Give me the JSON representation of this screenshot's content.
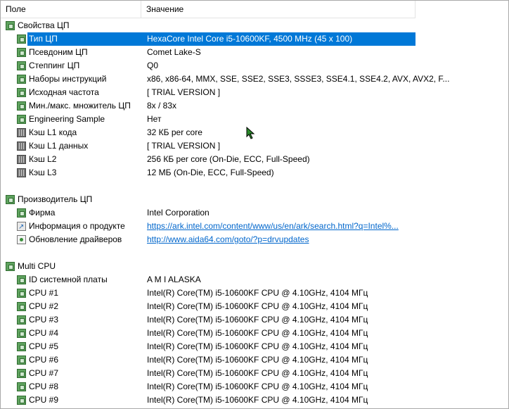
{
  "header": {
    "field_label": "Поле",
    "value_label": "Значение"
  },
  "sections": [
    {
      "title": "Свойства ЦП",
      "items": [
        {
          "label": "Тип ЦП",
          "value": "HexaCore Intel Core i5-10600KF, 4500 MHz (45 x 100)",
          "icon": "green-square-icon",
          "selected": true
        },
        {
          "label": "Псевдоним ЦП",
          "value": "Comet Lake-S",
          "icon": "green-square-icon"
        },
        {
          "label": "Степпинг ЦП",
          "value": "Q0",
          "icon": "green-square-icon"
        },
        {
          "label": "Наборы инструкций",
          "value": "x86, x86-64, MMX, SSE, SSE2, SSE3, SSSE3, SSE4.1, SSE4.2, AVX, AVX2, F...",
          "icon": "green-square-icon"
        },
        {
          "label": "Исходная частота",
          "value": "[ TRIAL VERSION ]",
          "icon": "green-square-icon"
        },
        {
          "label": "Мин./макс. множитель ЦП",
          "value": "8x / 83x",
          "icon": "green-square-icon"
        },
        {
          "label": "Engineering Sample",
          "value": "Нет",
          "icon": "green-square-icon"
        },
        {
          "label": "Кэш L1 кода",
          "value": "32 КБ per core",
          "icon": "memory-chip-icon"
        },
        {
          "label": "Кэш L1 данных",
          "value": "[ TRIAL VERSION ]",
          "icon": "memory-chip-icon"
        },
        {
          "label": "Кэш L2",
          "value": "256 КБ per core  (On-Die, ECC, Full-Speed)",
          "icon": "memory-chip-icon"
        },
        {
          "label": "Кэш L3",
          "value": "12 МБ  (On-Die, ECC, Full-Speed)",
          "icon": "memory-chip-icon"
        }
      ]
    },
    {
      "title": "Производитель ЦП",
      "items": [
        {
          "label": "Фирма",
          "value": "Intel Corporation",
          "icon": "green-square-icon"
        },
        {
          "label": "Информация о продукте",
          "value": "https://ark.intel.com/content/www/us/en/ark/search.html?q=Intel%...",
          "icon": "link-icon",
          "link": true
        },
        {
          "label": "Обновление драйверов",
          "value": "http://www.aida64.com/goto/?p=drvupdates",
          "icon": "update-icon",
          "link": true
        }
      ]
    },
    {
      "title": "Multi CPU",
      "items": [
        {
          "label": "ID системной платы",
          "value": "A M I ALASKA",
          "icon": "green-square-icon"
        },
        {
          "label": "CPU #1",
          "value": "Intel(R) Core(TM) i5-10600KF CPU @ 4.10GHz, 4104 МГц",
          "icon": "green-square-icon"
        },
        {
          "label": "CPU #2",
          "value": "Intel(R) Core(TM) i5-10600KF CPU @ 4.10GHz, 4104 МГц",
          "icon": "green-square-icon"
        },
        {
          "label": "CPU #3",
          "value": "Intel(R) Core(TM) i5-10600KF CPU @ 4.10GHz, 4104 МГц",
          "icon": "green-square-icon"
        },
        {
          "label": "CPU #4",
          "value": "Intel(R) Core(TM) i5-10600KF CPU @ 4.10GHz, 4104 МГц",
          "icon": "green-square-icon"
        },
        {
          "label": "CPU #5",
          "value": "Intel(R) Core(TM) i5-10600KF CPU @ 4.10GHz, 4104 МГц",
          "icon": "green-square-icon"
        },
        {
          "label": "CPU #6",
          "value": "Intel(R) Core(TM) i5-10600KF CPU @ 4.10GHz, 4104 МГц",
          "icon": "green-square-icon"
        },
        {
          "label": "CPU #7",
          "value": "Intel(R) Core(TM) i5-10600KF CPU @ 4.10GHz, 4104 МГц",
          "icon": "green-square-icon"
        },
        {
          "label": "CPU #8",
          "value": "Intel(R) Core(TM) i5-10600KF CPU @ 4.10GHz, 4104 МГц",
          "icon": "green-square-icon"
        },
        {
          "label": "CPU #9",
          "value": "Intel(R) Core(TM) i5-10600KF CPU @ 4.10GHz, 4104 МГц",
          "icon": "green-square-icon"
        }
      ]
    }
  ]
}
